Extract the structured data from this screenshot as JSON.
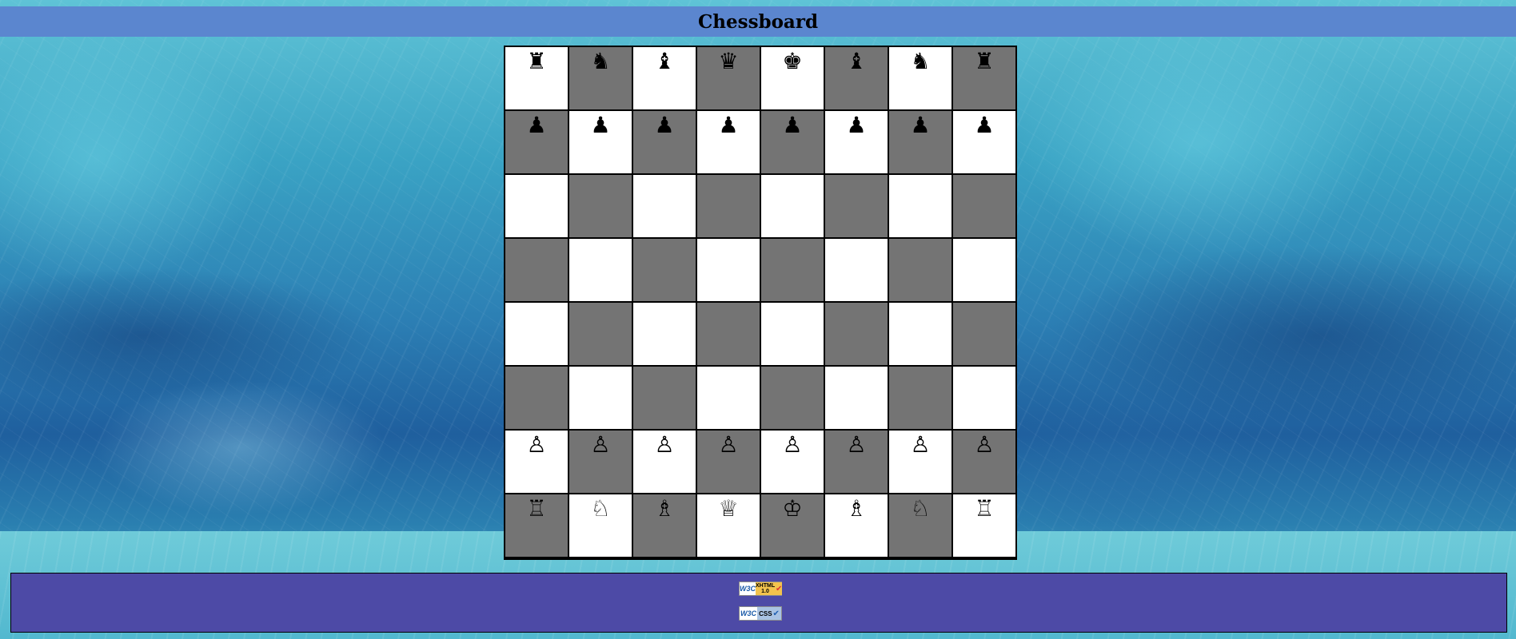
{
  "page": {
    "title": "Chessboard"
  },
  "colors": {
    "header_bg": "#5b86cf",
    "light_square": "#ffffff",
    "dark_square": "#747474",
    "footer_bg": "#4d4aa6"
  },
  "board": {
    "rows": [
      [
        "♜",
        "♞",
        "♝",
        "♛",
        "♚",
        "♝",
        "♞",
        "♜"
      ],
      [
        "♟",
        "♟",
        "♟",
        "♟",
        "♟",
        "♟",
        "♟",
        "♟"
      ],
      [
        "",
        "",
        "",
        "",
        "",
        "",
        "",
        ""
      ],
      [
        "",
        "",
        "",
        "",
        "",
        "",
        "",
        ""
      ],
      [
        "",
        "",
        "",
        "",
        "",
        "",
        "",
        ""
      ],
      [
        "",
        "",
        "",
        "",
        "",
        "",
        "",
        ""
      ],
      [
        "♙",
        "♙",
        "♙",
        "♙",
        "♙",
        "♙",
        "♙",
        "♙"
      ],
      [
        "♖",
        "♘",
        "♗",
        "♕",
        "♔",
        "♗",
        "♘",
        "♖"
      ]
    ]
  },
  "footer": {
    "badges": [
      {
        "w3c": "W3C",
        "kind": "XHTML 1.0",
        "icon": "check-icon"
      },
      {
        "w3c": "W3C",
        "kind": "CSS",
        "icon": "check-icon"
      }
    ]
  }
}
